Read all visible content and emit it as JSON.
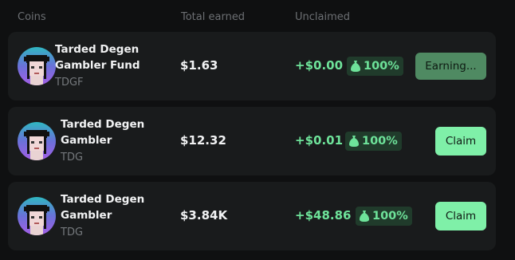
{
  "header": {
    "coins": "Coins",
    "total_earned": "Total earned",
    "unclaimed": "Unclaimed"
  },
  "rows": [
    {
      "name": "Tarded Degen Gambler Fund",
      "ticker": "TDGF",
      "total_earned": "$1.63",
      "unclaimed": "+$0.00",
      "percent": "100%",
      "button": "Earning..."
    },
    {
      "name": "Tarded Degen Gambler",
      "ticker": "TDG",
      "total_earned": "$12.32",
      "unclaimed": "+$0.01",
      "percent": "100%",
      "button": "Claim"
    },
    {
      "name": "Tarded Degen Gambler",
      "ticker": "TDG",
      "total_earned": "$3.84K",
      "unclaimed": "+$48.86",
      "percent": "100%",
      "button": "Claim"
    }
  ],
  "colors": {
    "accent": "#7ff0a8",
    "accent_text": "#6ee39a",
    "badge_bg": "#203b2b",
    "row_bg": "#191b1c",
    "page_bg": "#0f1011"
  },
  "icons": {
    "avatar": "pixel-avatar-icon",
    "bag": "money-bag-icon"
  }
}
